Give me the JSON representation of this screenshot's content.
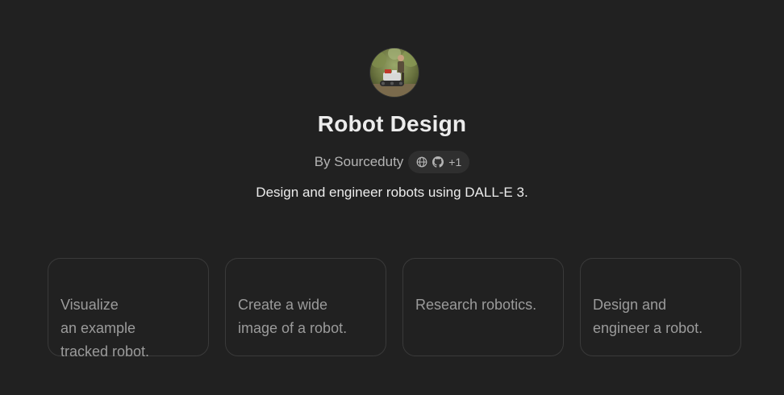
{
  "gpt": {
    "name": "Robot Design",
    "author": "By Sourceduty",
    "links_more": "+1",
    "description": "Design and engineer robots using DALL-E 3.",
    "avatar_icon": "robot-photo-avatar",
    "link_icons": [
      "globe-icon",
      "github-icon"
    ]
  },
  "starters": [
    {
      "text": "Visualize\nan example\ntracked robot."
    },
    {
      "text": "Create a wide\nimage of a robot."
    },
    {
      "text": "Research robotics."
    },
    {
      "text": "Design and\nengineer a robot."
    }
  ],
  "colors": {
    "background": "#212121",
    "card_border": "#3a3a3a",
    "pill_bg": "#2f2f2f",
    "muted_text": "#9b9b9b"
  }
}
